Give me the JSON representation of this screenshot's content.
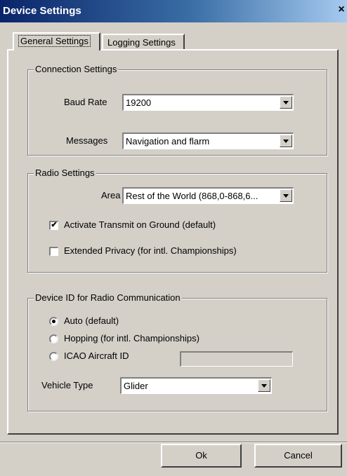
{
  "window": {
    "title": "Device Settings",
    "close_glyph": "×"
  },
  "tabs": [
    {
      "label": "General Settings",
      "active": true
    },
    {
      "label": "Logging Settings",
      "active": false
    }
  ],
  "connection": {
    "legend": "Connection Settings",
    "baud_label": "Baud Rate",
    "baud_value": "19200",
    "messages_label": "Messages",
    "messages_value": "Navigation and flarm"
  },
  "radio": {
    "legend": "Radio Settings",
    "area_label": "Area",
    "area_value": "Rest of the World (868,0-868,6...",
    "activate_label": "Activate Transmit on Ground (default)",
    "activate_checked": true,
    "privacy_label": "Extended Privacy (for intl. Championships)",
    "privacy_checked": false
  },
  "device_id": {
    "legend": "Device ID for Radio Communication",
    "auto_label": "Auto (default)",
    "hopping_label": "Hopping (for intl. Championships)",
    "icao_label": "ICAO Aircraft ID",
    "icao_value": "",
    "selected": "auto",
    "vehicle_label": "Vehicle Type",
    "vehicle_value": "Glider"
  },
  "buttons": {
    "ok": "Ok",
    "cancel": "Cancel"
  },
  "icons": {
    "check": "✔"
  }
}
